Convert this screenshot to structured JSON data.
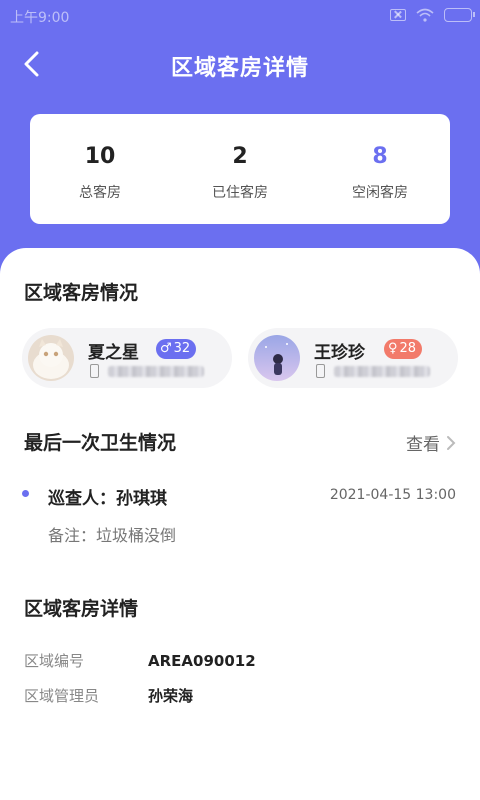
{
  "status_bar": {
    "time": "上午9:00"
  },
  "header": {
    "title": "区域客房详情"
  },
  "stats": [
    {
      "value": "10",
      "label": "总客房"
    },
    {
      "value": "2",
      "label": "已住客房"
    },
    {
      "value": "8",
      "label": "空闲客房"
    }
  ],
  "occupants_section": {
    "title": "区域客房情况",
    "people": [
      {
        "name": "夏之星",
        "gender_symbol": "♂",
        "age": "32",
        "gender": "male"
      },
      {
        "name": "王珍珍",
        "gender_symbol": "♀",
        "age": "28",
        "gender": "female"
      }
    ]
  },
  "hygiene_section": {
    "title": "最后一次卫生情况",
    "view_label": "查看",
    "inspector": "巡查人：孙琪琪",
    "time": "2021-04-15 13:00",
    "remark": "备注：垃圾桶没倒"
  },
  "detail_section": {
    "title": "区域客房详情",
    "rows": [
      {
        "key": "区域编号",
        "value": "AREA090012"
      },
      {
        "key": "区域管理员",
        "value": "孙荣海"
      }
    ]
  },
  "colors": {
    "accent": "#6b6ff0",
    "female_badge": "#f27a6a"
  }
}
